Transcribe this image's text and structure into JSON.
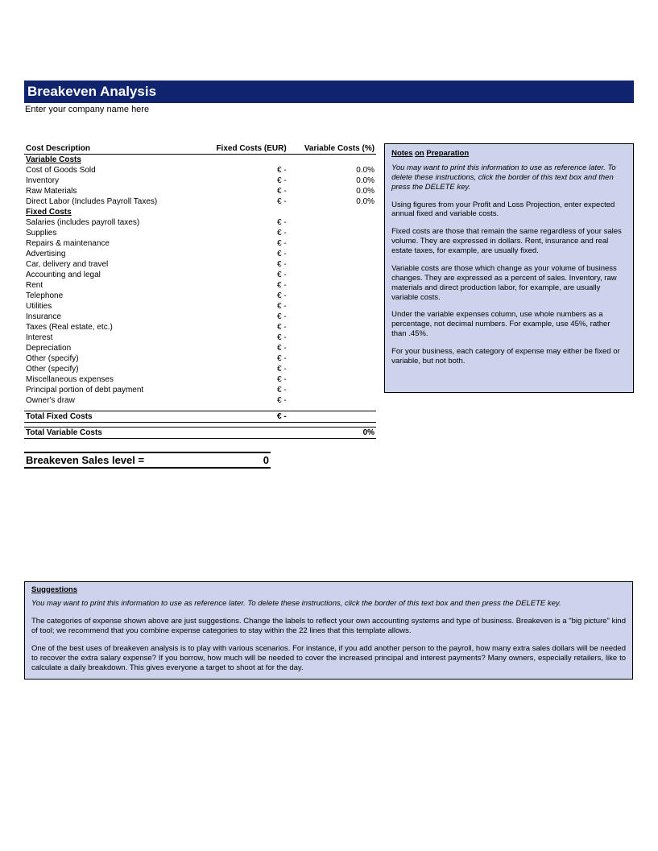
{
  "header": {
    "title": "Breakeven Analysis",
    "subtitle": "Enter your company name here"
  },
  "columns": {
    "desc": "Cost Description",
    "fixed": "Fixed Costs (EUR)",
    "variable": "Variable Costs (%)"
  },
  "variable_costs": {
    "heading": "Variable Costs",
    "rows": [
      {
        "label": "Cost of Goods Sold",
        "fixed": "€ -",
        "variable": "0.0%"
      },
      {
        "label": "Inventory",
        "fixed": "€ -",
        "variable": "0.0%"
      },
      {
        "label": "Raw Materials",
        "fixed": "€ -",
        "variable": "0.0%"
      },
      {
        "label": "Direct Labor (Includes Payroll Taxes)",
        "fixed": "€ -",
        "variable": "0.0%"
      }
    ]
  },
  "fixed_costs": {
    "heading": "Fixed Costs",
    "rows": [
      {
        "label": "Salaries (includes payroll taxes)",
        "fixed": "€ -"
      },
      {
        "label": "Supplies",
        "fixed": "€ -"
      },
      {
        "label": "Repairs & maintenance",
        "fixed": "€ -"
      },
      {
        "label": "Advertising",
        "fixed": "€ -"
      },
      {
        "label": "Car, delivery and travel",
        "fixed": "€ -"
      },
      {
        "label": "Accounting and legal",
        "fixed": "€ -"
      },
      {
        "label": "Rent",
        "fixed": "€ -"
      },
      {
        "label": "Telephone",
        "fixed": "€ -"
      },
      {
        "label": "Utilities",
        "fixed": "€ -"
      },
      {
        "label": "Insurance",
        "fixed": "€ -"
      },
      {
        "label": "Taxes (Real estate, etc.)",
        "fixed": "€ -"
      },
      {
        "label": "Interest",
        "fixed": "€ -"
      },
      {
        "label": "Depreciation",
        "fixed": "€ -"
      },
      {
        "label": "Other (specify)",
        "fixed": "€ -"
      },
      {
        "label": "Other (specify)",
        "fixed": "€ -"
      },
      {
        "label": "Miscellaneous expenses",
        "fixed": "€ -"
      },
      {
        "label": "Principal portion of debt payment",
        "fixed": "€ -"
      },
      {
        "label": "Owner's draw",
        "fixed": "€ -"
      }
    ]
  },
  "totals": {
    "fixed_label": "Total Fixed Costs",
    "fixed_value": "€ -",
    "variable_label": "Total Variable Costs",
    "variable_value": "0%"
  },
  "breakeven": {
    "label": "Breakeven Sales level   =",
    "value": "0"
  },
  "notes": {
    "title_a": "Notes",
    "title_b": "on",
    "title_c": "Preparation",
    "p_intro": "You may want to print this information to use as reference later. To delete these instructions, click the border of this text box and then press the DELETE key.",
    "p1": "Using figures from your Profit and Loss Projection, enter expected annual fixed and variable costs.",
    "p2": "Fixed costs are those that remain the same regardless of your sales volume. They are expressed in dollars. Rent, insurance and real estate taxes, for example, are usually fixed.",
    "p3": "Variable costs are those which change as your volume of business changes. They are expressed as a percent of sales. Inventory, raw materials and direct production labor, for example, are usually variable costs.",
    "p4": "Under the variable expenses column, use whole numbers as a percentage, not decimal numbers. For example, use 45%, rather than .45%.",
    "p5": "For your business, each category of expense may either be  fixed or variable, but not both."
  },
  "suggestions": {
    "title": "Suggestions",
    "p_intro": "You may want to print this information to use as reference later. To delete these instructions, click the border of this text box and then press the DELETE key.",
    "p1": "The categories of expense shown above are just suggestions. Change the labels to reflect your own accounting systems and type of business. Breakeven is a \"big picture\" kind of tool; we recommend that you combine expense categories to stay within the 22 lines that this template allows.",
    "p2": "One of the best uses of breakeven analysis is to play with various scenarios. For instance, if you add another person to the payroll, how many extra sales dollars will be needed to recover the extra salary expense? If you borrow, how much will be needed to cover the increased principal and interest payments? Many owners, especially retailers, like to calculate a daily breakdown. This gives everyone a target to shoot at for the day."
  }
}
